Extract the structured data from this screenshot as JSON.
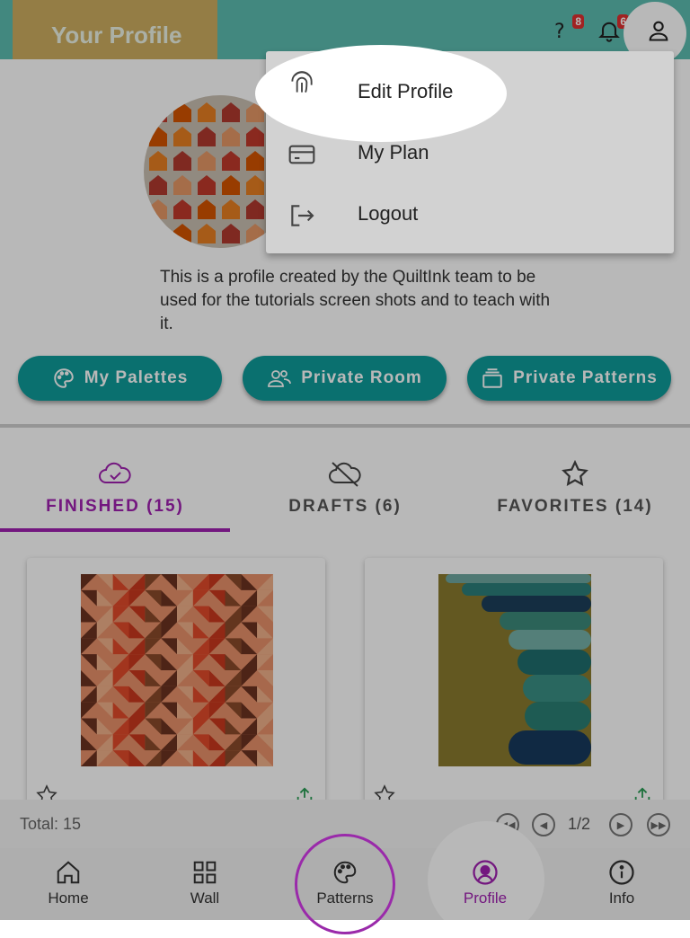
{
  "header": {
    "title": "Your Profile",
    "help_badge": "8",
    "notifications_badge": "6",
    "accent_color": "#5cbdb0"
  },
  "profile": {
    "bio": "This is a profile created by the QuiltInk team to be used for the tutorials screen shots and to teach with it."
  },
  "actions": [
    {
      "label": "My Palettes",
      "icon": "palette-icon"
    },
    {
      "label": "Private Room",
      "icon": "people-icon"
    },
    {
      "label": "Private Patterns",
      "icon": "stack-icon"
    }
  ],
  "tabs": [
    {
      "label": "FINISHED (15)",
      "icon": "cloud-check-icon",
      "active": true
    },
    {
      "label": "DRAFTS (6)",
      "icon": "cloud-off-icon",
      "active": false
    },
    {
      "label": "FAVORITES (14)",
      "icon": "star-icon",
      "active": false
    }
  ],
  "footer": {
    "total_label": "Total: 15",
    "page_indicator": "1/2"
  },
  "nav": [
    {
      "label": "Home",
      "icon": "home-icon"
    },
    {
      "label": "Wall",
      "icon": "grid-icon"
    },
    {
      "label": "Patterns",
      "icon": "palette-icon"
    },
    {
      "label": "Profile",
      "icon": "person-circle-icon",
      "active": true
    },
    {
      "label": "Info",
      "icon": "info-icon"
    }
  ],
  "menu": {
    "items": [
      {
        "label": "Edit Profile",
        "icon": "fingerprint-icon"
      },
      {
        "label": "My Plan",
        "icon": "card-icon"
      },
      {
        "label": "Logout",
        "icon": "logout-icon"
      }
    ]
  },
  "colors": {
    "teal": "#0e9b9a",
    "purple": "#a020b0",
    "orange": "#e0ac52"
  }
}
